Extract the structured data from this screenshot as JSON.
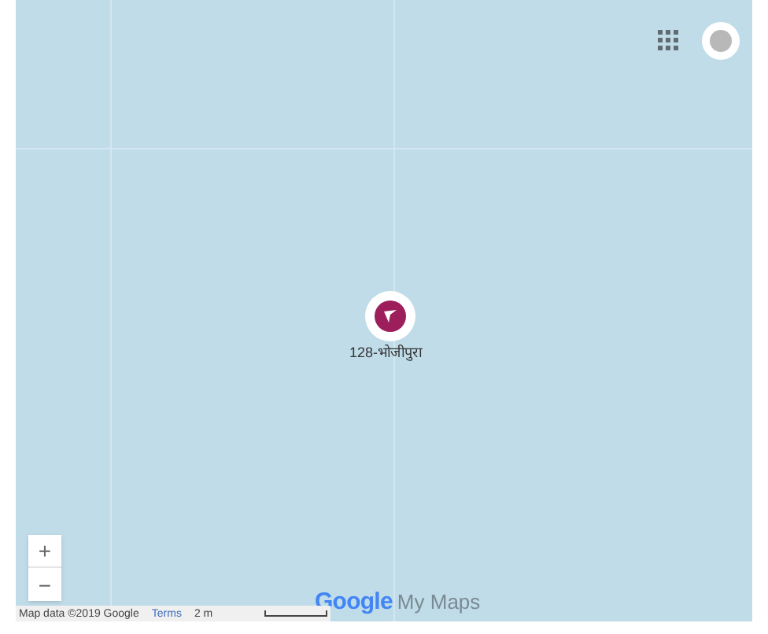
{
  "map": {
    "marker": {
      "label": "128-भोजीपुरा"
    },
    "zoom_controls": {
      "zoom_in": "+",
      "zoom_out": "−"
    },
    "branding": {
      "logo": "Google",
      "product": "My Maps"
    },
    "attribution": {
      "map_data": "Map data ©2019 Google",
      "terms": "Terms",
      "scale": "2 m"
    }
  }
}
